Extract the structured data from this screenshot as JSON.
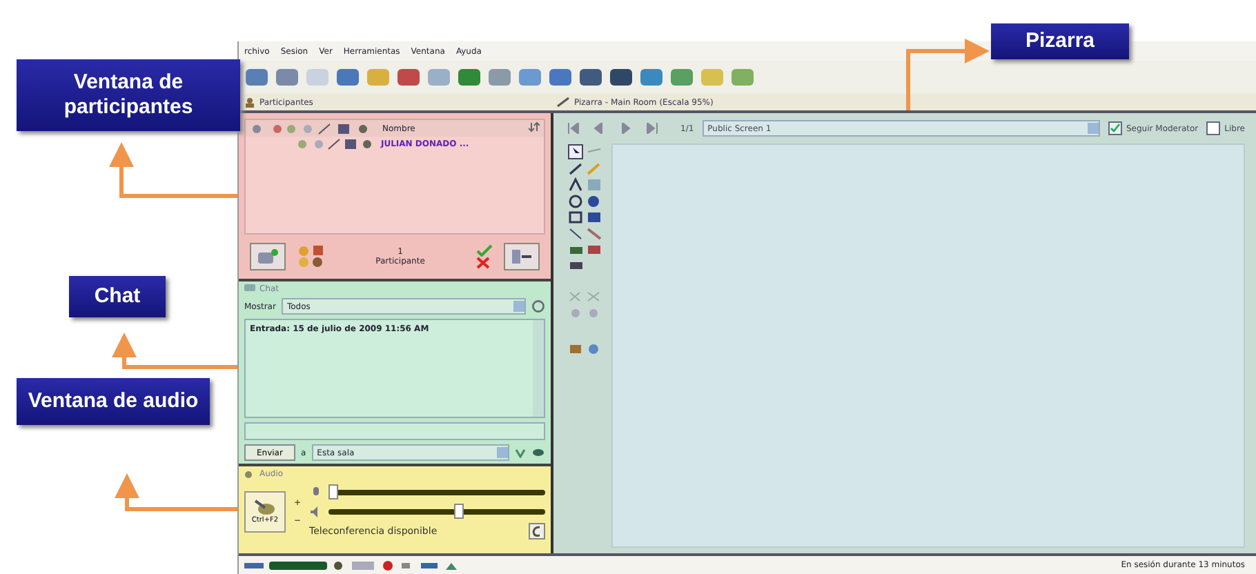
{
  "callouts": [
    {
      "text": "Ventana de participantes"
    },
    {
      "text": "Chat"
    },
    {
      "text": "Ventana de audio"
    },
    {
      "text": "Pizarra"
    }
  ],
  "menu": [
    "rchivo",
    "Sesion",
    "Ver",
    "Herramientas",
    "Ventana",
    "Ayuda"
  ],
  "participants": {
    "title": "Participantes",
    "header": "Nombre",
    "rows": [
      {
        "name": "JULIAN DONADO ..."
      }
    ],
    "count": "1",
    "count_label": "Participante"
  },
  "chat": {
    "title": "Chat",
    "show_label": "Mostrar",
    "show_value": "Todos",
    "messages": [
      "Entrada: 15 de julio de 2009 11:56 AM"
    ],
    "send": "Enviar",
    "to_label": "a",
    "to_value": "Esta sala"
  },
  "audio": {
    "title": "Audio",
    "talk_key": "Ctrl+F2",
    "plus": "+",
    "minus": "−",
    "sliders": [
      {
        "kind": "mic",
        "level": 0.02
      },
      {
        "kind": "speaker",
        "level": 0.6
      }
    ],
    "status": "Teleconferencia disponible"
  },
  "whiteboard": {
    "title": "Pizarra - Main Room (Escala 95%)",
    "page": "1/1",
    "screen": "Public Screen 1",
    "options": [
      {
        "label": "Seguir Moderator",
        "checked": true
      },
      {
        "label": "Libre",
        "checked": false
      }
    ]
  },
  "status_bar": {
    "text": "En sesión durante 13 minutos"
  }
}
